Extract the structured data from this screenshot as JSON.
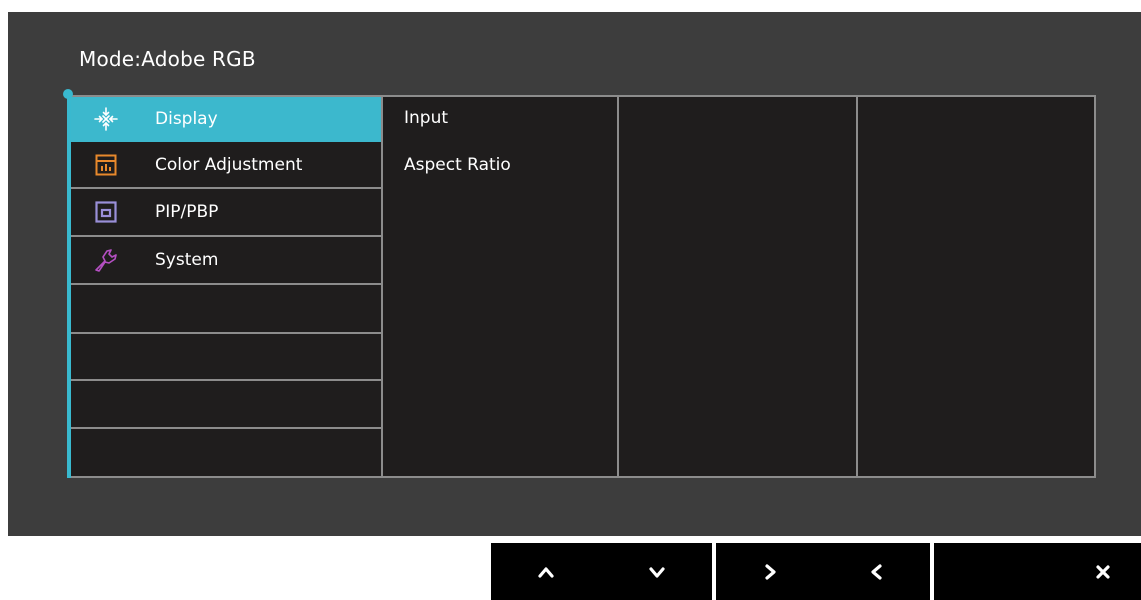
{
  "osd": {
    "mode_label": "Mode:",
    "mode_value": "Adobe RGB"
  },
  "menu": {
    "items": [
      {
        "label": "Display",
        "icon": "display-icon",
        "active": true
      },
      {
        "label": "Color Adjustment",
        "icon": "color-adjustment-icon",
        "active": false
      },
      {
        "label": "PIP/PBP",
        "icon": "pip-pbp-icon",
        "active": false
      },
      {
        "label": "System",
        "icon": "wrench-icon",
        "active": false
      }
    ],
    "submenu": [
      "Input",
      "Aspect Ratio"
    ]
  },
  "keys": {
    "up": "^",
    "down": "v",
    "right": ">",
    "left": "<",
    "close": "×"
  },
  "colors": {
    "accent": "#3cb8cd",
    "panel": "#1f1d1d",
    "osd_background": "#3d3d3d",
    "icon_orange": "#e8892c",
    "icon_purple": "#9a8fd8",
    "icon_magenta": "#b44fc2"
  }
}
